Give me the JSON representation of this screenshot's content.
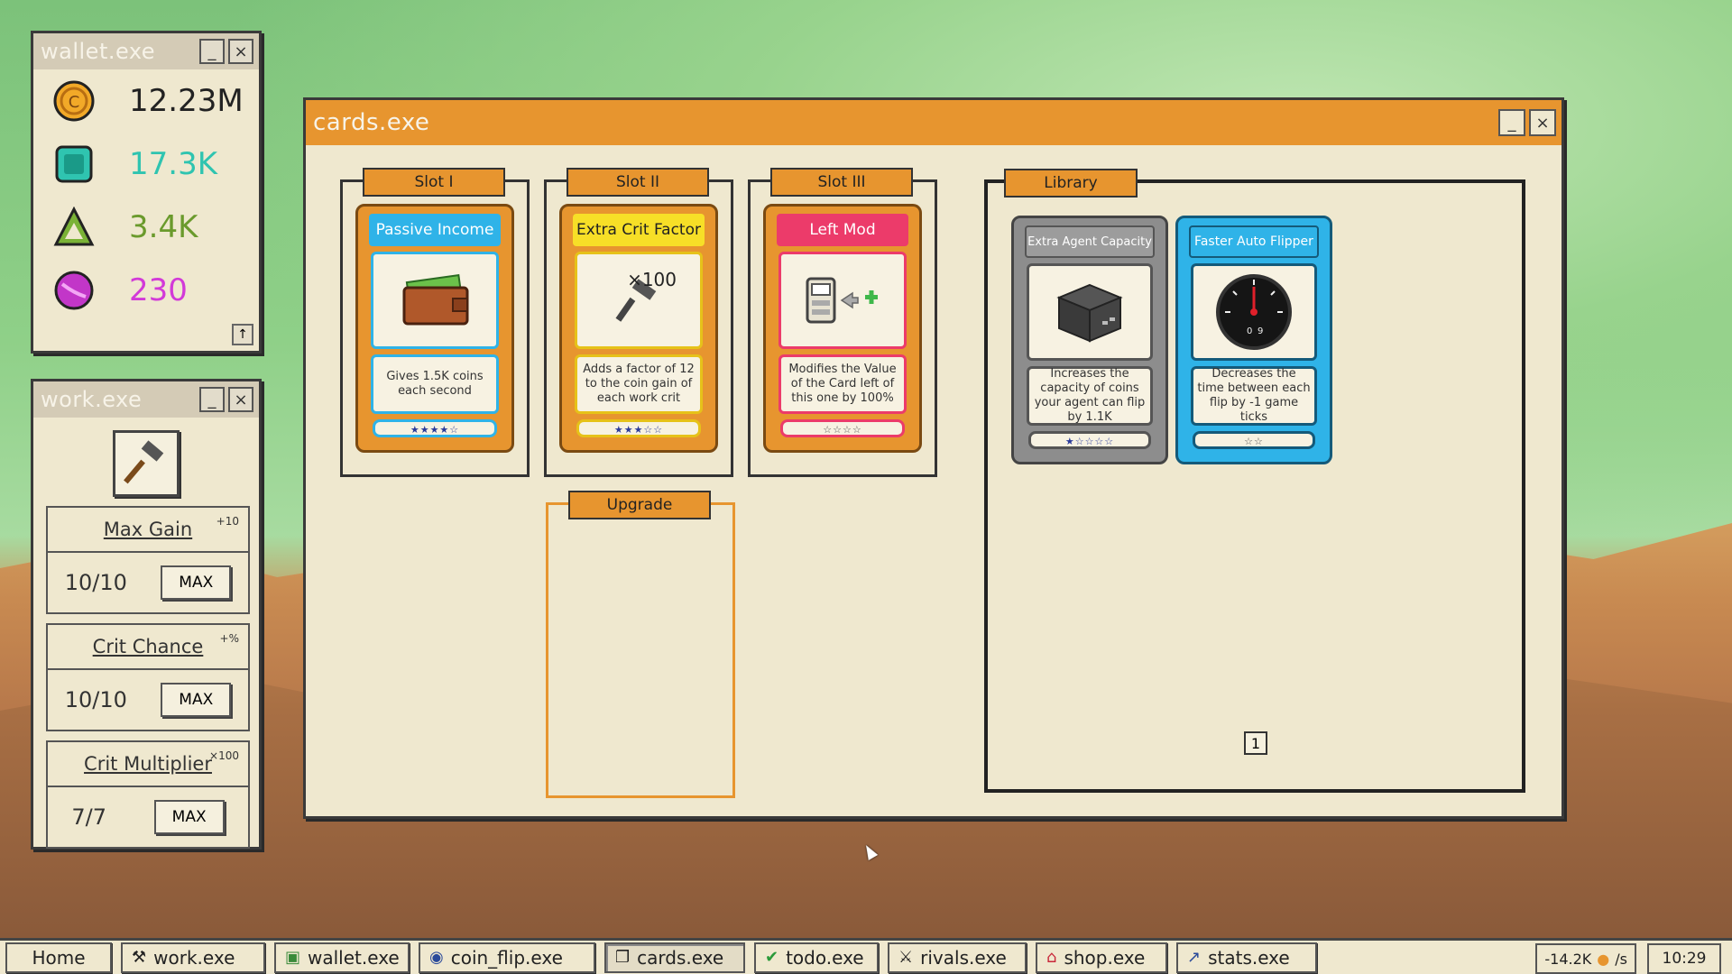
{
  "wallet_window": {
    "title": "wallet.exe",
    "minimize": "_",
    "close": "×",
    "scroll_up": "↑",
    "items": [
      {
        "icon": "coin-icon",
        "value": "12.23M",
        "color": "#222222"
      },
      {
        "icon": "gem-icon",
        "value": "17.3K",
        "color": "#2fc4b0"
      },
      {
        "icon": "triangle-icon",
        "value": "3.4K",
        "color": "#6a9a2c"
      },
      {
        "icon": "orb-icon",
        "value": "230",
        "color": "#d23ad8"
      }
    ]
  },
  "work_window": {
    "title": "work.exe",
    "minimize": "_",
    "close": "×",
    "upgrades": [
      {
        "name": "Max Gain",
        "mini": "+10",
        "level": "10/10",
        "button": "MAX"
      },
      {
        "name": "Crit Chance",
        "mini": "+%",
        "level": "10/10",
        "button": "MAX"
      },
      {
        "name": "Crit Multiplier",
        "mini": "×100",
        "level": "7/7",
        "button": "MAX"
      }
    ]
  },
  "cards_window": {
    "title": "cards.exe",
    "minimize": "_",
    "close": "×",
    "slots": [
      {
        "label": "Slot I",
        "card": {
          "name": "Passive Income",
          "desc": "Gives 1.5K coins each second",
          "stars": "★★★★☆",
          "style": "c-gold"
        }
      },
      {
        "label": "Slot II",
        "card": {
          "name": "Extra Crit Factor",
          "art_text": "×100",
          "desc": "Adds a factor of 12 to the coin gain of each work crit",
          "stars": "★★★☆☆",
          "style": "c-gold2"
        }
      },
      {
        "label": "Slot III",
        "card": {
          "name": "Left Mod",
          "desc": "Modifies the Value of the Card left of this one by 100%",
          "stars": "☆☆☆☆",
          "style": "c-red"
        }
      }
    ],
    "upgrade_label": "Upgrade",
    "library_label": "Library",
    "library_cards": [
      {
        "name": "Extra Agent Capacity",
        "desc": "Increases the capacity of coins your agent can flip by 1.1K",
        "stars": "★☆☆☆☆",
        "style": "c-gray"
      },
      {
        "name": "Faster Auto Flipper",
        "desc": "Decreases the time between each flip by -1 game ticks",
        "stars": "☆☆",
        "style": "c-blue"
      }
    ],
    "page": "1"
  },
  "taskbar": {
    "items": [
      {
        "label": "Home",
        "icon": ""
      },
      {
        "label": "work.exe",
        "icon": "hammer-icon"
      },
      {
        "label": "wallet.exe",
        "icon": "wallet-icon"
      },
      {
        "label": "coin_flip.exe",
        "icon": "coin-icon"
      },
      {
        "label": "cards.exe",
        "icon": "cards-icon",
        "active": true
      },
      {
        "label": "todo.exe",
        "icon": "check-icon"
      },
      {
        "label": "rivals.exe",
        "icon": "swords-icon"
      },
      {
        "label": "shop.exe",
        "icon": "shop-icon"
      },
      {
        "label": "stats.exe",
        "icon": "chart-icon"
      }
    ],
    "rate": "-14.2K",
    "rate_unit": "/s",
    "clock": "10:29"
  }
}
